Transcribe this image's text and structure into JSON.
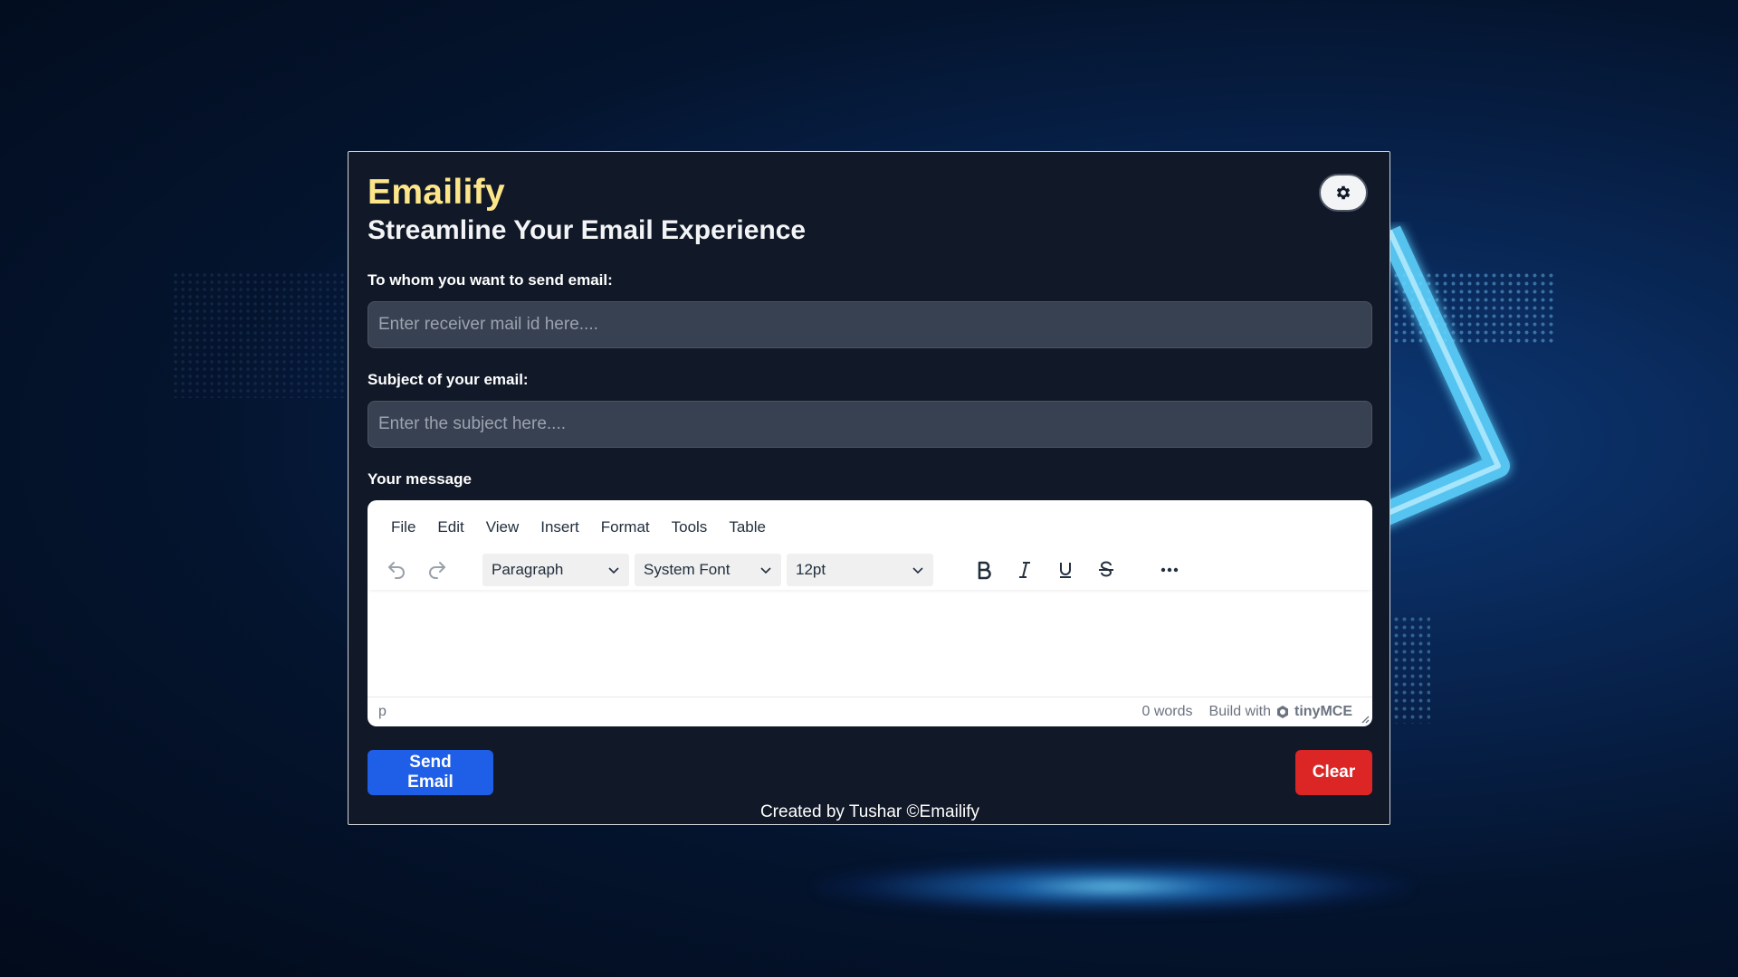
{
  "app": {
    "brand": "Emailify",
    "tagline": "Streamline Your Email Experience"
  },
  "theme_toggle": {
    "icon": "gear-icon"
  },
  "form": {
    "to_label": "To whom you want to send email:",
    "to_placeholder": "Enter receiver mail id here....",
    "to_value": "",
    "subject_label": "Subject of your email:",
    "subject_placeholder": "Enter the subject here....",
    "subject_value": "",
    "message_label": "Your message"
  },
  "editor": {
    "menu": [
      "File",
      "Edit",
      "View",
      "Insert",
      "Format",
      "Tools",
      "Table"
    ],
    "block_format": "Paragraph",
    "font_family": "System Font",
    "font_size": "12pt",
    "content": "",
    "status_path": "p",
    "word_count": "0 words",
    "built_with": "Build with",
    "tiny_brand": "tinyMCE"
  },
  "actions": {
    "send_label": "Send Email",
    "clear_label": "Clear"
  },
  "footer": {
    "credit": "Created by Tushar ©Emailify"
  },
  "colors": {
    "brand": "#fde68a",
    "card_bg": "#111827",
    "input_bg": "#374151",
    "send_btn": "#1f5fe8",
    "clear_btn": "#dc2626"
  }
}
